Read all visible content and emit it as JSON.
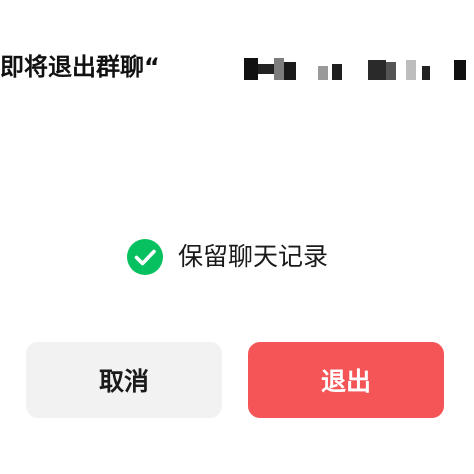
{
  "dialog": {
    "title_prefix": "即将退出群聊“",
    "keep_history": {
      "label": "保留聊天记录",
      "checked": true,
      "check_color": "#07c160"
    },
    "buttons": {
      "cancel_label": "取消",
      "exit_label": "退出"
    },
    "colors": {
      "exit_button": "#f65558",
      "cancel_button": "#f2f2f2"
    }
  }
}
